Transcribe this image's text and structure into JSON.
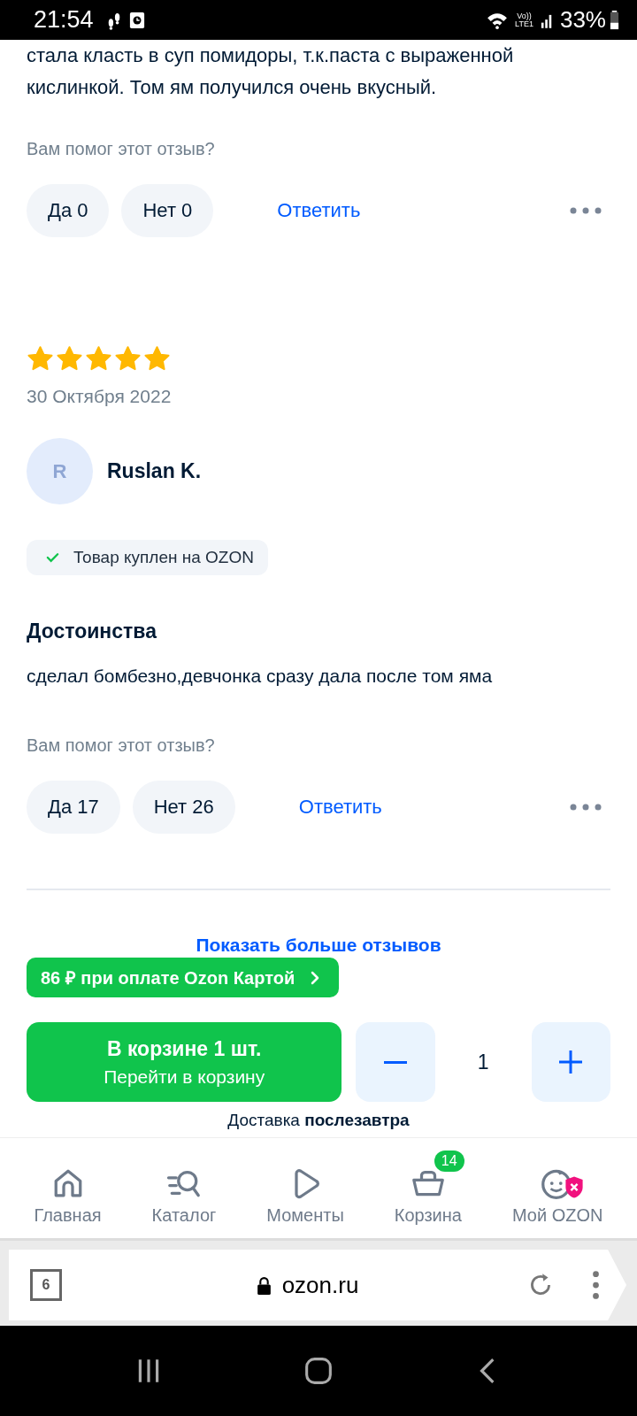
{
  "status_bar": {
    "time": "21:54",
    "network_top": "Vo))",
    "network_bottom": "LTE1",
    "battery": "33%"
  },
  "reviews": [
    {
      "text": "стала класть в суп помидоры, т.к.паста с выраженной кислинкой. Том ям получился очень вкусный.",
      "helpful_prompt": "Вам помог этот отзыв?",
      "yes": "Да 0",
      "no": "Нет 0",
      "reply": "Ответить"
    },
    {
      "stars": 5,
      "date": "30 Октября 2022",
      "avatar_letter": "R",
      "author": "Ruslan K.",
      "verified": "Товар куплен на OZON",
      "sections": [
        {
          "title": "Достоинства",
          "text": "сделал бомбезно,девчонка сразу дала после том яма"
        }
      ],
      "helpful_prompt": "Вам помог этот отзыв?",
      "yes": "Да 17",
      "no": "Нет 26",
      "reply": "Ответить"
    }
  ],
  "show_more": "Показать больше отзывов",
  "promo_banner": "86 ₽ при оплате Ozon Картой",
  "cart": {
    "title": "В корзине 1 шт.",
    "subtitle": "Перейти в корзину",
    "quantity": "1",
    "delivery": "Доставка **послезавтра**"
  },
  "bottom_nav": [
    {
      "kind": "home",
      "label": "Главная"
    },
    {
      "kind": "catalog",
      "label": "Каталог"
    },
    {
      "kind": "moments",
      "label": "Моменты"
    },
    {
      "kind": "cart",
      "label": "Корзина",
      "badge": "14"
    },
    {
      "kind": "profile",
      "label": "Мой OZON",
      "alert": true
    }
  ],
  "browser": {
    "tab_count": "6",
    "url": "ozon.ru"
  }
}
